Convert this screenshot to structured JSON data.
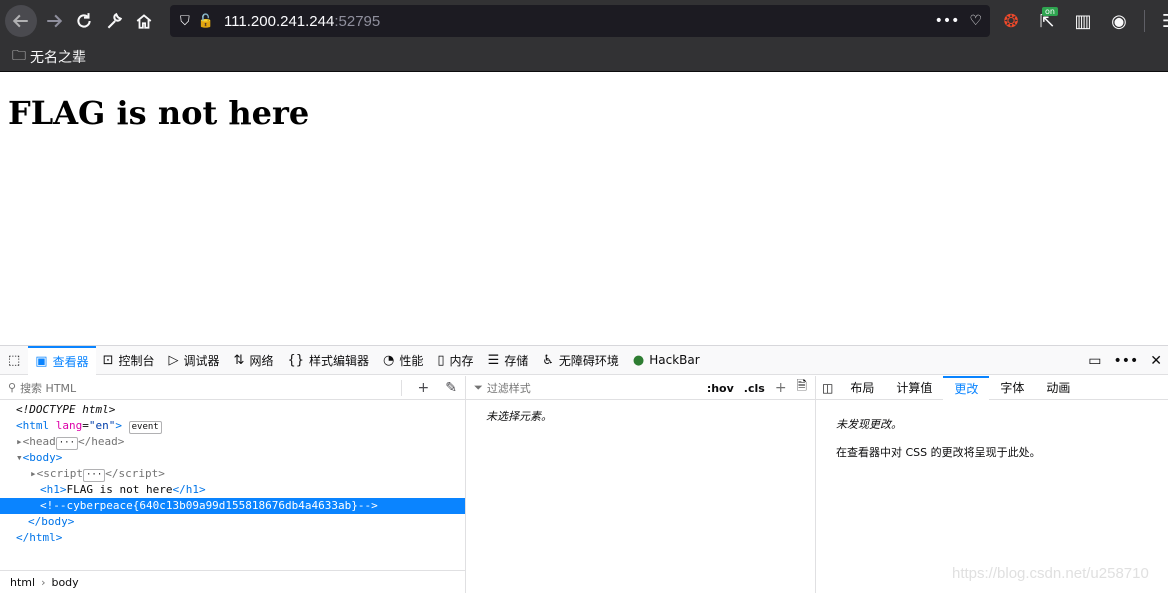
{
  "browser": {
    "url_host": "111.200.241.244",
    "url_port": ":52795",
    "ext_badge": "on"
  },
  "bookmarks": {
    "folder_label": "无名之辈"
  },
  "page": {
    "heading": "FLAG is not here"
  },
  "devtools": {
    "tabs": [
      {
        "label": "查看器",
        "icon": "inspector-icon"
      },
      {
        "label": "控制台",
        "icon": "console-icon"
      },
      {
        "label": "调试器",
        "icon": "debugger-icon"
      },
      {
        "label": "网络",
        "icon": "network-icon"
      },
      {
        "label": "样式编辑器",
        "icon": "style-editor-icon"
      },
      {
        "label": "性能",
        "icon": "performance-icon"
      },
      {
        "label": "内存",
        "icon": "memory-icon"
      },
      {
        "label": "存储",
        "icon": "storage-icon"
      },
      {
        "label": "无障碍环境",
        "icon": "accessibility-icon"
      },
      {
        "label": "HackBar",
        "icon": "hackbar-icon"
      }
    ],
    "search_placeholder": "搜索 HTML",
    "filter_placeholder": "过滤样式",
    "hov_label": ":hov",
    "cls_label": ".cls",
    "tree": {
      "doctype": "<!DOCTYPE html>",
      "html_open_tag": "html",
      "lang_attr": "lang",
      "lang_val": "\"en\"",
      "event_badge": "event",
      "head_tag": "head",
      "body_tag": "body",
      "script_tag": "script",
      "h1_text": "FLAG is not here",
      "comment": "<!--cyberpeace{640c13b09a99d155818676db4a4633ab}-->"
    },
    "breadcrumb": [
      "html",
      "body"
    ],
    "no_element_msg": "未选择元素。",
    "right_tabs": [
      "布局",
      "计算值",
      "更改",
      "字体",
      "动画"
    ],
    "no_changes_msg": "未发现更改。",
    "changes_hint": "在查看器中对 CSS 的更改将呈现于此处。"
  },
  "watermark": "https://blog.csdn.net/u258710"
}
